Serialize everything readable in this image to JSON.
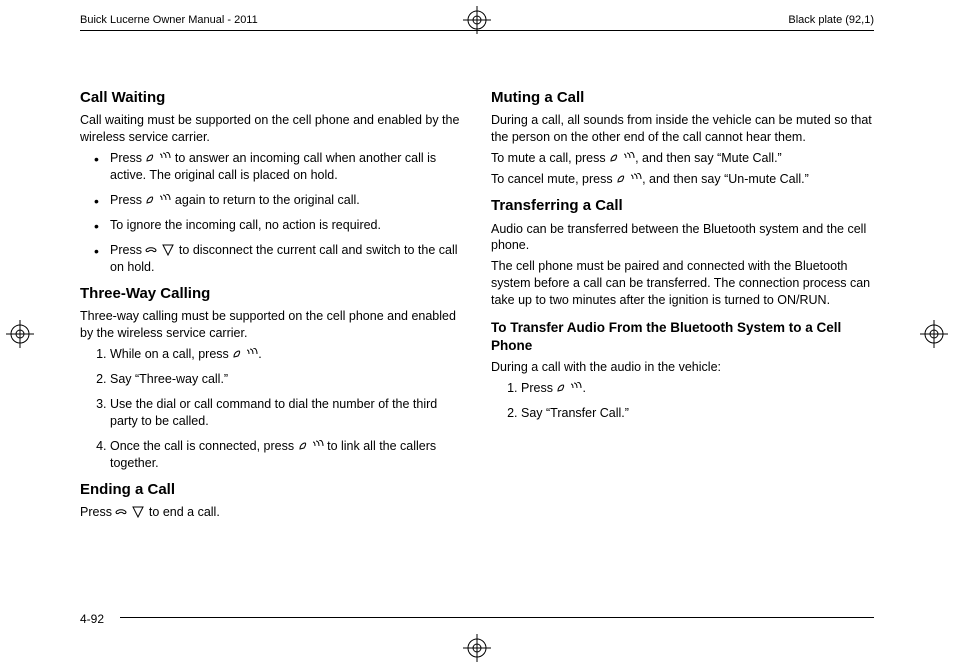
{
  "header": {
    "left": "Buick Lucerne Owner Manual - 2011",
    "right": "Black plate (92,1)"
  },
  "pagenum": "4-92",
  "left": {
    "h1": "Call Waiting",
    "p1": "Call waiting must be supported on the cell phone and enabled by the wireless service carrier.",
    "b1a": "Press ",
    "b1b": " to answer an incoming call when another call is active. The original call is placed on hold.",
    "b2a": "Press ",
    "b2b": " again to return to the original call.",
    "b3": "To ignore the incoming call, no action is required.",
    "b4a": "Press ",
    "b4b": " to disconnect the current call and switch to the call on hold.",
    "h2": "Three-Way Calling",
    "p2": "Three-way calling must be supported on the cell phone and enabled by the wireless service carrier.",
    "s1a": "While on a call, press ",
    "s1b": ".",
    "s2": "Say “Three-way call.”",
    "s3": "Use the dial or call command to dial the number of the third party to be called.",
    "s4a": "Once the call is connected, press ",
    "s4b": " to link all the callers together.",
    "h3": "Ending a Call",
    "p3a": "Press ",
    "p3b": " to end a call."
  },
  "right": {
    "h1": "Muting a Call",
    "p1": "During a call, all sounds from inside the vehicle can be muted so that the person on the other end of the call cannot hear them.",
    "p2a": "To mute a call, press ",
    "p2b": ", and then say “Mute Call.”",
    "p3a": "To cancel mute, press ",
    "p3b": ", and then say “Un-mute Call.”",
    "h2": "Transferring a Call",
    "p4": "Audio can be transferred between the Bluetooth system and the cell phone.",
    "p5": "The cell phone must be paired and connected with the Bluetooth system before a call can be transferred. The connection process can take up to two minutes after the ignition is turned to ON/RUN.",
    "h3": "To Transfer Audio From the Bluetooth System to a Cell Phone",
    "p6": "During a call with the audio in the vehicle:",
    "s1a": "Press ",
    "s1b": ".",
    "s2": "Say “Transfer Call.”"
  }
}
